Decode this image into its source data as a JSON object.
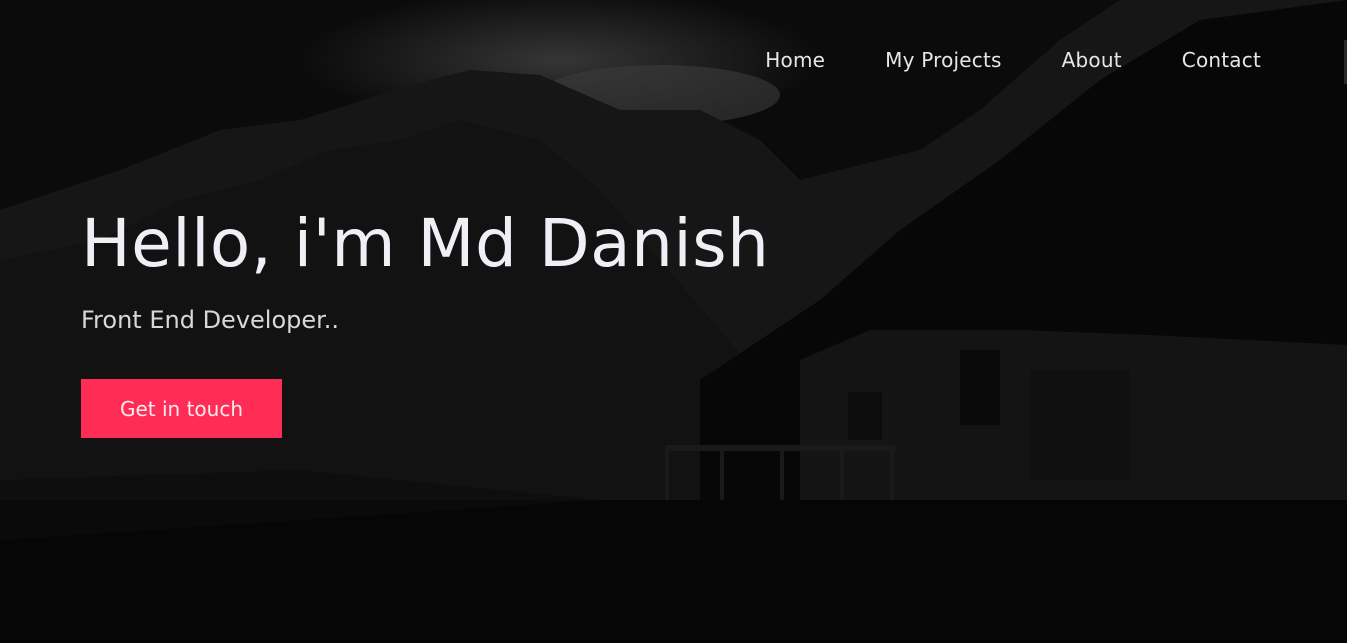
{
  "nav": {
    "items": [
      {
        "label": "Home"
      },
      {
        "label": "My Projects"
      },
      {
        "label": "About"
      },
      {
        "label": "Contact"
      }
    ]
  },
  "hero": {
    "title": "Hello, i'm Md Danish",
    "subtitle": "Front End Developer..",
    "cta_label": "Get in touch"
  },
  "colors": {
    "accent": "#ff2d55",
    "text": "#f1eef6",
    "background": "#050505"
  }
}
